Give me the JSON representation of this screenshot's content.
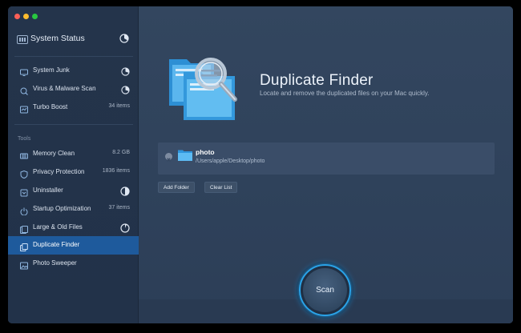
{
  "sidebar": {
    "system_status": {
      "label": "System Status",
      "icon": "system-status-icon"
    },
    "group1": [
      {
        "label": "System Junk",
        "icon": "monitor-icon",
        "indicator": "pie"
      },
      {
        "label": "Virus & Malware Scan",
        "icon": "shield-scan-icon",
        "indicator": "pie"
      },
      {
        "label": "Turbo Boost",
        "icon": "turbo-icon",
        "count": "34 items"
      }
    ],
    "tools_label": "Tools",
    "tools": [
      {
        "label": "Memory Clean",
        "icon": "memory-icon",
        "count": "8.2 GB"
      },
      {
        "label": "Privacy Protection",
        "icon": "privacy-shield-icon",
        "count": "1836 items"
      },
      {
        "label": "Uninstaller",
        "icon": "uninstaller-icon",
        "indicator": "pie-half"
      },
      {
        "label": "Startup Optimization",
        "icon": "power-icon",
        "count": "37 items"
      },
      {
        "label": "Large & Old Files",
        "icon": "files-icon",
        "indicator": "pie"
      },
      {
        "label": "Duplicate Finder",
        "icon": "duplicate-icon",
        "active": true
      },
      {
        "label": "Photo Sweeper",
        "icon": "photo-icon"
      }
    ]
  },
  "main": {
    "title": "Duplicate Finder",
    "subtitle": "Locate and remove the duplicated files on your Mac quickly.",
    "folder": {
      "name": "photo",
      "path": "/Users/apple/Desktop/photo"
    },
    "add_folder_label": "Add Folder",
    "clear_list_label": "Clear List",
    "scan_label": "Scan"
  },
  "colors": {
    "accent": "#2aa3e8",
    "active_item": "#1e5a9c",
    "sidebar_bg": "#24344b",
    "main_bg": "#32455e"
  }
}
